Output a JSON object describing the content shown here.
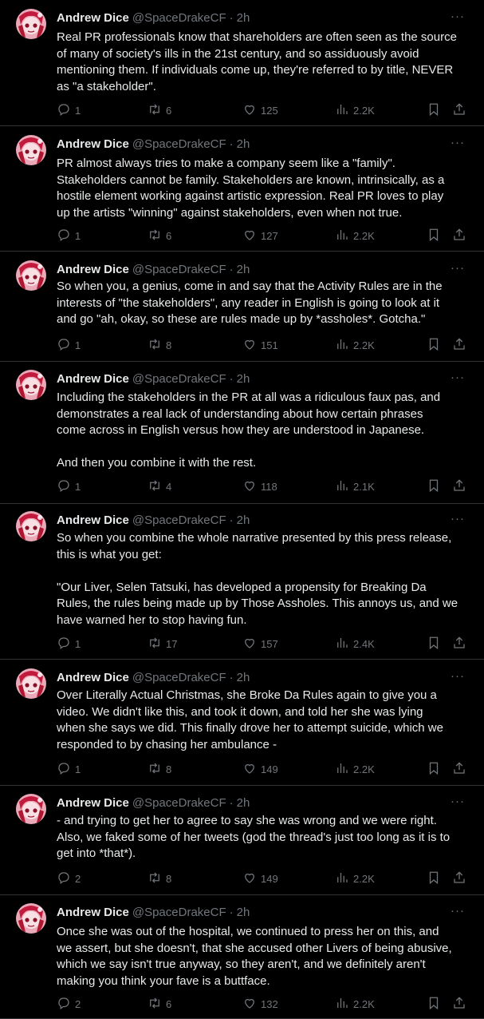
{
  "author": {
    "name": "Andrew Dice",
    "handle": "@SpaceDrakeCF",
    "time": "2h"
  },
  "icons": {
    "reply": "reply-icon",
    "retweet": "retweet-icon",
    "like": "heart-icon",
    "views": "views-icon",
    "bookmark": "bookmark-icon",
    "share": "share-icon",
    "more": "more-icon"
  },
  "colors": {
    "background": "#000000",
    "text": "#e7e9ea",
    "muted": "#71767b",
    "divider": "#2f3336"
  },
  "tweets": [
    {
      "text": "Real PR professionals know that shareholders are often seen as the source\nof many of society's ills in the 21st century, and so assiduously avoid\nmentioning them. If individuals come up, they're referred to by title, NEVER\nas \"a stakeholder\".",
      "replies": "1",
      "retweets": "6",
      "likes": "125",
      "views": "2.2K"
    },
    {
      "text": "PR almost always tries to make a company seem like a \"family\".\nStakeholders cannot be family. Stakeholders are known, intrinsically, as a\nhostile element working against artistic expression. Real PR loves to play\nup the artists \"winning\" against stakeholders, even when not true.",
      "replies": "1",
      "retweets": "6",
      "likes": "127",
      "views": "2.2K"
    },
    {
      "text": "So when you, a genius, come in and say that the Activity Rules are in the\ninterests of \"the stakeholders\", any reader in English is going to look at it\nand go \"ah, okay, so these are rules made up by *assholes*. Gotcha.\"",
      "replies": "1",
      "retweets": "8",
      "likes": "151",
      "views": "2.2K"
    },
    {
      "text": "Including the stakeholders in the PR at all was a ridiculous faux pas, and\ndemonstrates a real lack of understanding about how certain phrases\ncome across in English versus how they are understood in Japanese.\n\nAnd then you combine it with the rest.",
      "replies": "1",
      "retweets": "4",
      "likes": "118",
      "views": "2.1K"
    },
    {
      "text": "So when you combine the whole narrative presented by this press release,\nthis is what you get:\n\n\"Our Liver, Selen Tatsuki, has developed a propensity for Breaking Da\nRules, the rules being made up by Those Assholes. This annoys us, and we\nhave warned her to stop having fun.",
      "replies": "1",
      "retweets": "17",
      "likes": "157",
      "views": "2.4K"
    },
    {
      "text": "Over Literally Actual Christmas, she Broke Da Rules again to give you a\nvideo. We didn't like this, and took it down, and told her she was lying\nwhen she says we did. This finally drove her to attempt suicide, which we\nresponded to by chasing her ambulance -",
      "replies": "1",
      "retweets": "8",
      "likes": "149",
      "views": "2.2K"
    },
    {
      "text": "- and trying to get her to agree to say she was wrong and we were right.\nAlso, we faked some of her tweets (god the thread's just too long as it is to\nget into *that*).",
      "replies": "2",
      "retweets": "8",
      "likes": "149",
      "views": "2.2K"
    },
    {
      "text": "Once she was out of the hospital, we continued to press her on this, and\nwe assert, but she doesn't, that she accused other Livers of being abusive,\nwhich we say isn't true anyway, so they aren't, and we definitely aren't\nmaking you think your fave is a buttface.",
      "replies": "2",
      "retweets": "6",
      "likes": "132",
      "views": "2.2K"
    }
  ]
}
